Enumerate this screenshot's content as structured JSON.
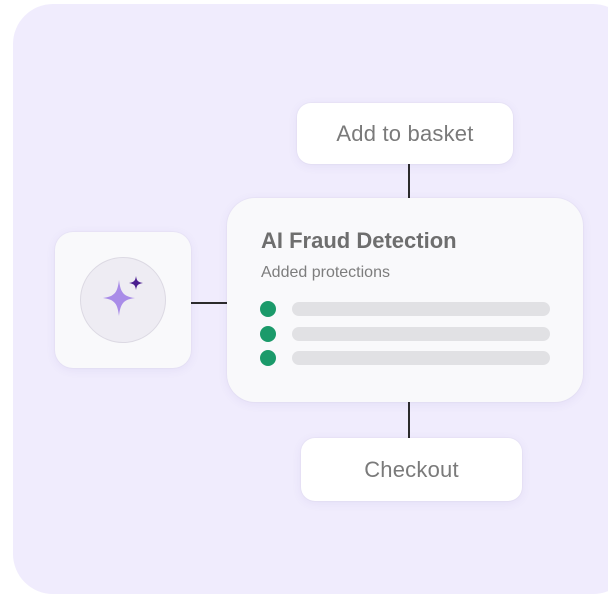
{
  "steps": {
    "add_to_basket": "Add to basket",
    "checkout": "Checkout"
  },
  "fraud_card": {
    "title": "AI Fraud Detection",
    "subtitle": "Added protections",
    "protections": 3
  },
  "icons": {
    "ai": "sparkle-icon"
  },
  "colors": {
    "background": "#f0ecfd",
    "sparkle_large": "#a98ce8",
    "sparkle_small": "#4a1d8f",
    "status_dot": "#1b9a6a",
    "placeholder_bar": "#e1e1e4"
  }
}
